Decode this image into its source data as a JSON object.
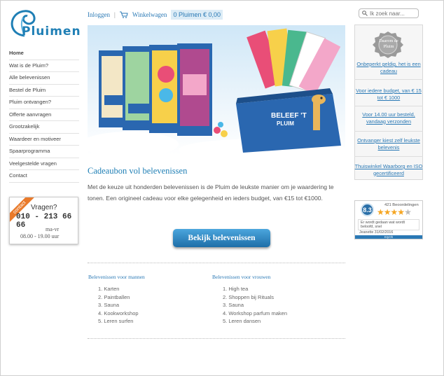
{
  "brand": {
    "name": "Pluimen",
    "accent": "#1f7fb5",
    "cta_color": "#2a79b5",
    "ribbon_color": "#e97a2b"
  },
  "topbar": {
    "login": "Inloggen",
    "separator": "|",
    "cart": "Winkelwagen",
    "cart_summary": "0 Pluimen € 0,00"
  },
  "search": {
    "placeholder": "Ik zoek naar...",
    "icon": "search-icon"
  },
  "nav": {
    "items": [
      {
        "label": "Home",
        "active": true
      },
      {
        "label": "Wat is de Pluim?"
      },
      {
        "label": "Alle belevenissen"
      },
      {
        "label": "Bestel de Pluim"
      },
      {
        "label": "Pluim ontvangen?"
      },
      {
        "label": "Offerte aanvragen"
      },
      {
        "label": "Grootzakelijk"
      },
      {
        "label": "Waardeer en motiveer"
      },
      {
        "label": "Spaarprogramma"
      },
      {
        "label": "Veelgestelde vragen"
      },
      {
        "label": "Contact"
      }
    ]
  },
  "contact_box": {
    "ribbon": "contact",
    "question": "Vragen?",
    "phone": "010 - 213 66 66",
    "days": "ma-vr",
    "hours": "08.00 - 19.00 uur"
  },
  "hero": {
    "box_text_line1": "BELEEF 'T",
    "box_text_line2": "PLUIM"
  },
  "main": {
    "title": "Cadeaubon vol belevenissen",
    "text": "Met de keuze uit honderden belevenissen is de Pluim de leukste manier om je waardering te tonen. Een origineel cadeau voor elke gelegenheid en ieders budget, van €15 tot €1000.",
    "cta": "Bekijk belevenissen"
  },
  "lists": {
    "men": {
      "title": "Belevenissen voor mannen",
      "items": [
        "1. Karten",
        "2. Paintballen",
        "3. Sauna",
        "4. Kookworkshop",
        "5. Leren surfen"
      ]
    },
    "women": {
      "title": "Belevenissen voor vrouwen",
      "items": [
        "1. High tea",
        "2. Shoppen bij Rituals",
        "3. Sauna",
        "4. Workshop parfum maken",
        "5. Leren dansen"
      ]
    }
  },
  "sidebar": {
    "seal": "Daarom de Pluim",
    "usps": [
      "Onbeperkt geldig, het is een cadeau",
      "Voor iedere budget, van € 15 tot € 1000",
      "Voor 14.00 uur besteld, vandaag verzonden",
      "Ontvanger kiest zelf leukste belevenis",
      "Thuiswinkel Waarborg en ISO gecertificeerd"
    ]
  },
  "kiyoh": {
    "score": "8.3",
    "reviews": "421 Beoordelingen",
    "rating": 4,
    "quote": "Er wordt gedaan wat wordt beloofd, snel",
    "author": "Jeanette 31/02/2016",
    "brand": "KIyOh"
  }
}
